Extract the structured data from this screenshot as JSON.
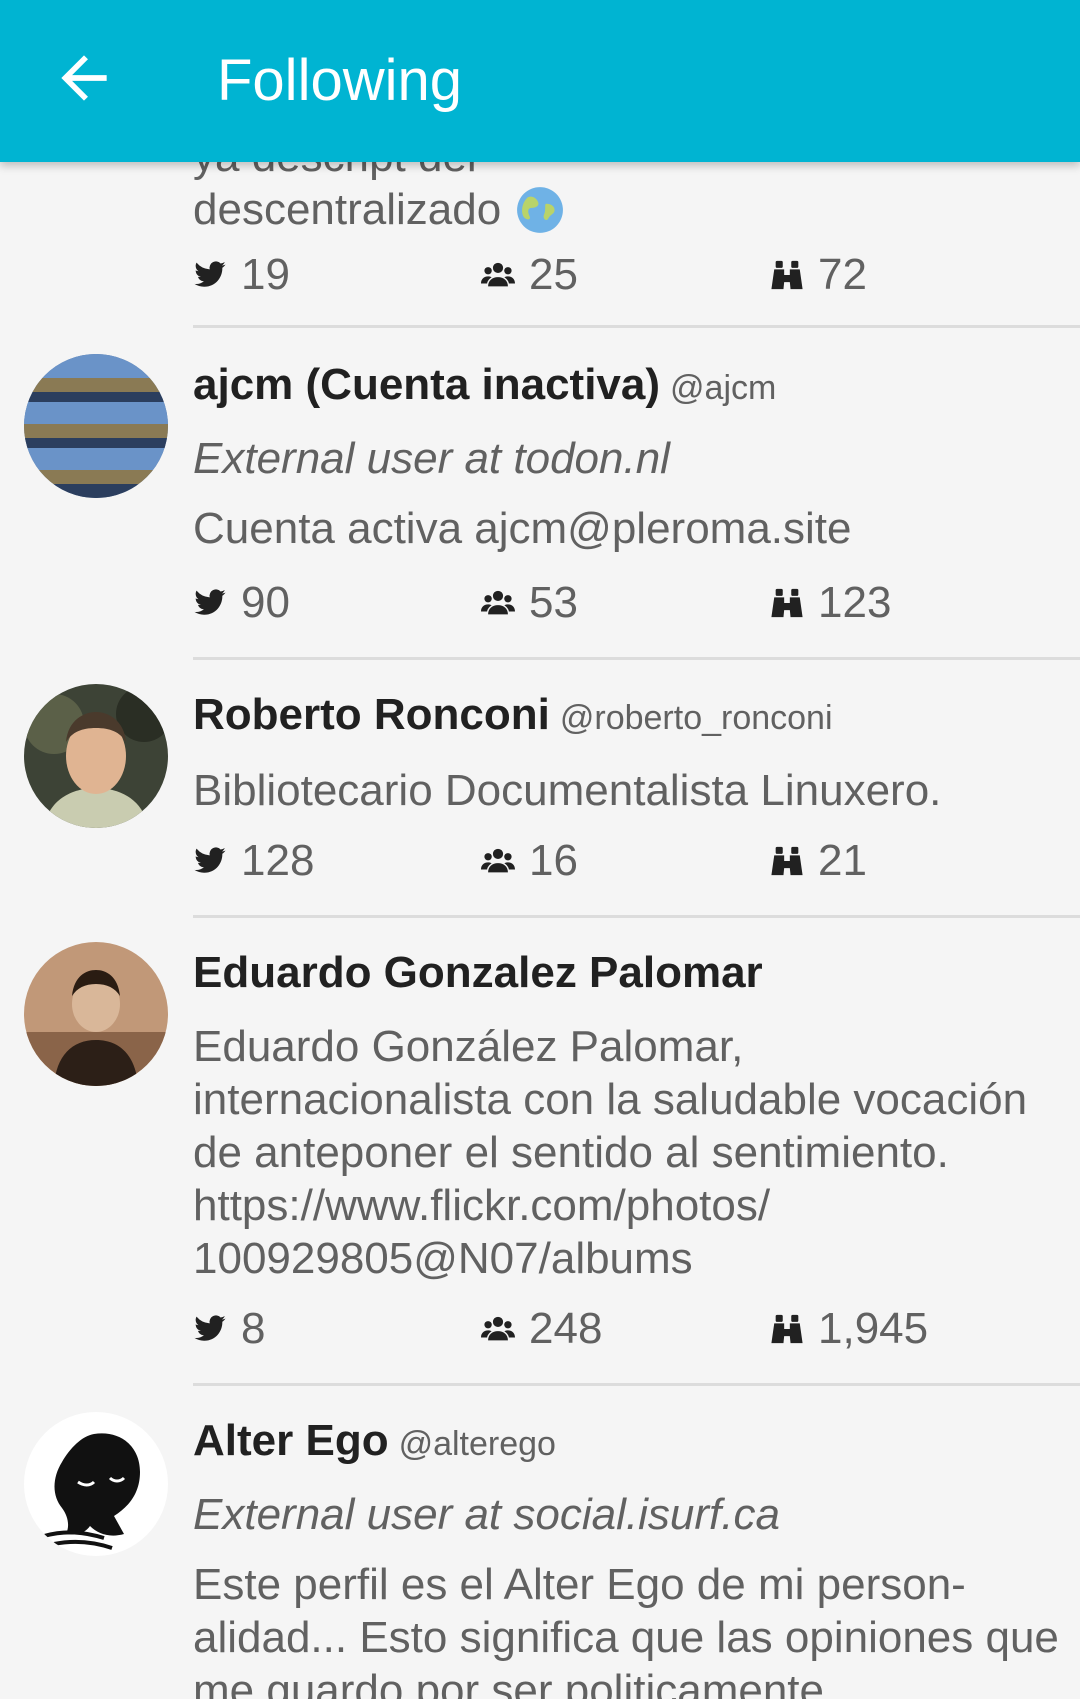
{
  "header": {
    "title": "Following"
  },
  "partial": {
    "bio_line1": "ya descript del",
    "bio_line2": "descentralizado",
    "tweets": "19",
    "followers": "25",
    "following": "72"
  },
  "users": [
    {
      "name": "ajcm (Cuenta inactiva)",
      "handle": "@ajcm",
      "external": "External user at todon.nl",
      "bio": "Cuenta activa ajcm@pleroma.site",
      "tweets": "90",
      "followers": "53",
      "following": "123"
    },
    {
      "name": "Roberto Ronconi",
      "handle": "@roberto_ronconi",
      "bio": "Bibliotecario Documentalista Linuxero.",
      "tweets": "128",
      "followers": "16",
      "following": "21"
    },
    {
      "name": "Eduardo Gonzalez Palomar",
      "bio": "Eduardo González Palomar, internacionalista con la saludable vocación de anteponer el sentido al sentimiento. https://www.flickr.com/photos/ 100929805@N07/albums",
      "tweets": "8",
      "followers": "248",
      "following": "1,945"
    },
    {
      "name": "Alter Ego",
      "handle": "@alterego",
      "external": "External user at social.isurf.ca",
      "bio": "Este perfil es el Alter Ego de mi person-alidad... Esto significa que las opiniones que me guardo por ser politicamente"
    }
  ],
  "icons": {
    "tweets": "bird-icon",
    "followers": "group-icon",
    "following": "binoculars-icon",
    "back": "arrow-left-icon",
    "globe": "globe-emoji-icon"
  },
  "colors": {
    "appbar": "#00b4d2",
    "background": "#f5f5f5",
    "text_primary": "#212121",
    "text_secondary": "#616161"
  }
}
